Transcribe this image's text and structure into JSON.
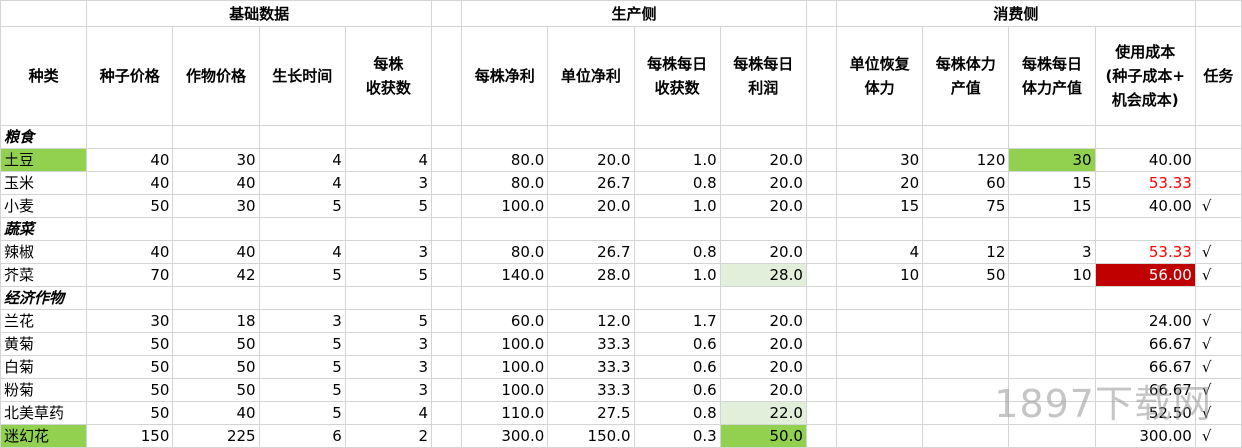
{
  "groups": {
    "basic": "基础数据",
    "production": "生产侧",
    "consumption": "消费侧"
  },
  "headers": {
    "kind": "种类",
    "seed_price": "种子价格",
    "crop_price": "作物价格",
    "grow_time": "生长时间",
    "harvest_per_plant": "每株\n收获数",
    "net_per_plant": "每株净利",
    "unit_net": "单位净利",
    "daily_harvest": "每株每日\n收获数",
    "daily_profit": "每株每日\n利润",
    "unit_stamina": "单位恢复\n体力",
    "stamina_value": "每株体力\n产值",
    "daily_stamina": "每株每日\n体力产值",
    "use_cost": "使用成本\n(种子成本+\n机会成本)",
    "task": "任务"
  },
  "categories": {
    "grain": "粮食",
    "veg": "蔬菜",
    "cash": "经济作物"
  },
  "rows": {
    "potato": {
      "name": "土豆",
      "seed": "40",
      "crop": "30",
      "grow": "4",
      "harvest": "4",
      "net": "80.0",
      "unit": "20.0",
      "dh": "1.0",
      "dp": "20.0",
      "us": "30",
      "sv": "120",
      "ds": "30",
      "uc": "40.00",
      "task": ""
    },
    "corn": {
      "name": "玉米",
      "seed": "40",
      "crop": "40",
      "grow": "4",
      "harvest": "3",
      "net": "80.0",
      "unit": "26.7",
      "dh": "0.8",
      "dp": "20.0",
      "us": "20",
      "sv": "60",
      "ds": "15",
      "uc": "53.33",
      "task": ""
    },
    "wheat": {
      "name": "小麦",
      "seed": "50",
      "crop": "30",
      "grow": "5",
      "harvest": "5",
      "net": "100.0",
      "unit": "20.0",
      "dh": "1.0",
      "dp": "20.0",
      "us": "15",
      "sv": "75",
      "ds": "15",
      "uc": "40.00",
      "task": "√"
    },
    "pepper": {
      "name": "辣椒",
      "seed": "40",
      "crop": "40",
      "grow": "4",
      "harvest": "3",
      "net": "80.0",
      "unit": "26.7",
      "dh": "0.8",
      "dp": "20.0",
      "us": "4",
      "sv": "12",
      "ds": "3",
      "uc": "53.33",
      "task": "√"
    },
    "mustard": {
      "name": "芥菜",
      "seed": "70",
      "crop": "42",
      "grow": "5",
      "harvest": "5",
      "net": "140.0",
      "unit": "28.0",
      "dh": "1.0",
      "dp": "28.0",
      "us": "10",
      "sv": "50",
      "ds": "10",
      "uc": "56.00",
      "task": "√"
    },
    "orchid": {
      "name": "兰花",
      "seed": "30",
      "crop": "18",
      "grow": "3",
      "harvest": "5",
      "net": "60.0",
      "unit": "12.0",
      "dh": "1.7",
      "dp": "20.0",
      "us": "",
      "sv": "",
      "ds": "",
      "uc": "24.00",
      "task": "√"
    },
    "ymum": {
      "name": "黄菊",
      "seed": "50",
      "crop": "50",
      "grow": "5",
      "harvest": "3",
      "net": "100.0",
      "unit": "33.3",
      "dh": "0.6",
      "dp": "20.0",
      "us": "",
      "sv": "",
      "ds": "",
      "uc": "66.67",
      "task": "√"
    },
    "wmum": {
      "name": "白菊",
      "seed": "50",
      "crop": "50",
      "grow": "5",
      "harvest": "3",
      "net": "100.0",
      "unit": "33.3",
      "dh": "0.6",
      "dp": "20.0",
      "us": "",
      "sv": "",
      "ds": "",
      "uc": "66.67",
      "task": "√"
    },
    "pmum": {
      "name": "粉菊",
      "seed": "50",
      "crop": "50",
      "grow": "5",
      "harvest": "3",
      "net": "100.0",
      "unit": "33.3",
      "dh": "0.6",
      "dp": "20.0",
      "us": "",
      "sv": "",
      "ds": "",
      "uc": "66.67",
      "task": "√"
    },
    "herb": {
      "name": "北美草药",
      "seed": "50",
      "crop": "40",
      "grow": "5",
      "harvest": "4",
      "net": "110.0",
      "unit": "27.5",
      "dh": "0.8",
      "dp": "22.0",
      "us": "",
      "sv": "",
      "ds": "",
      "uc": "52.50",
      "task": "√"
    },
    "rosemary": {
      "name": "迷幻花",
      "seed": "150",
      "crop": "225",
      "grow": "6",
      "harvest": "2",
      "net": "300.0",
      "unit": "150.0",
      "dh": "0.3",
      "dp": "50.0",
      "us": "",
      "sv": "",
      "ds": "",
      "uc": "300.00",
      "task": "√"
    }
  },
  "watermark": "1897下载网"
}
